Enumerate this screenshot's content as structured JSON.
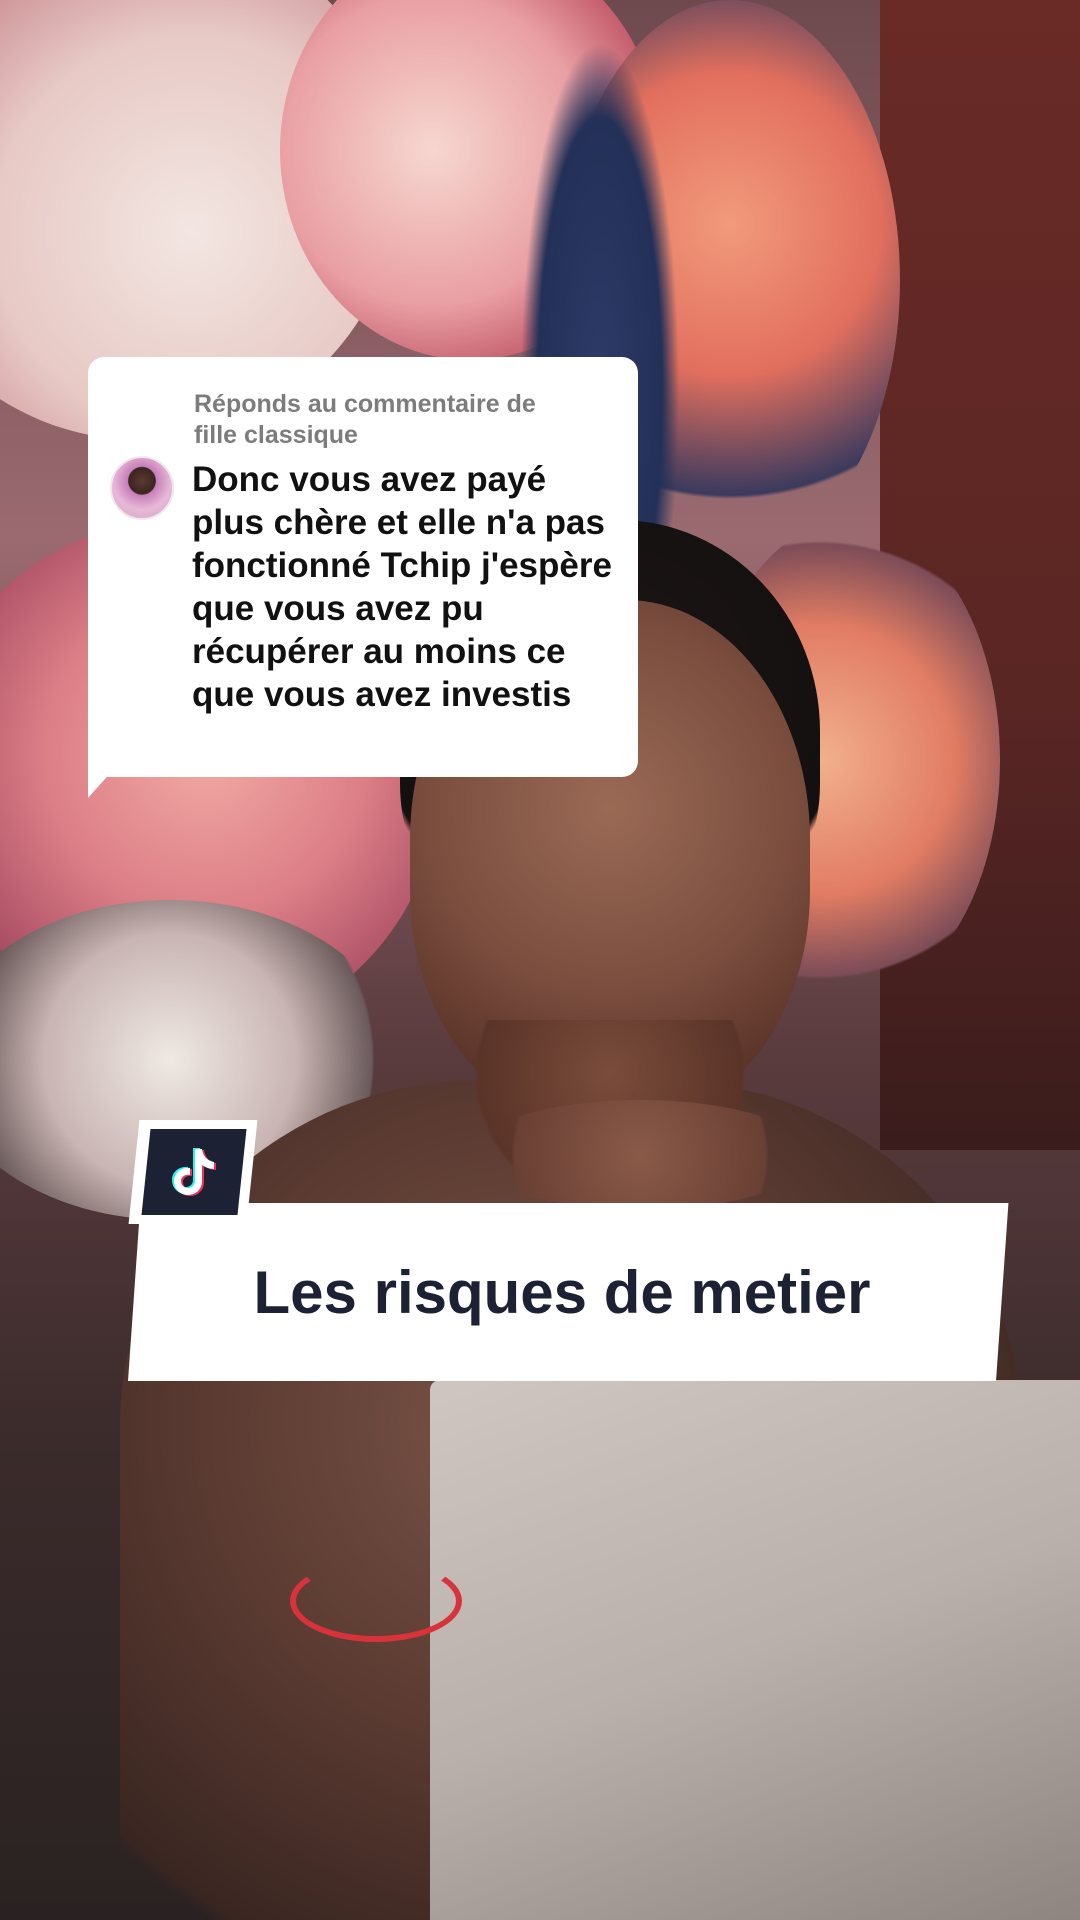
{
  "comment_reply": {
    "header": "Réponds au commentaire de\nfille classique",
    "text": "Donc vous avez payé plus chère et elle n'a pas fonctionné Tchip j'espère que vous avez pu récupérer au moins ce que vous avez investis"
  },
  "caption": {
    "text": "Les risques de metier"
  },
  "badge": {
    "icon": "tiktok-logo-icon"
  },
  "colors": {
    "bubble_bg": "#ffffff",
    "header_text": "#7c7c7c",
    "comment_text": "#111111",
    "caption_text": "#1c2233",
    "badge_bg": "#1c2233"
  }
}
